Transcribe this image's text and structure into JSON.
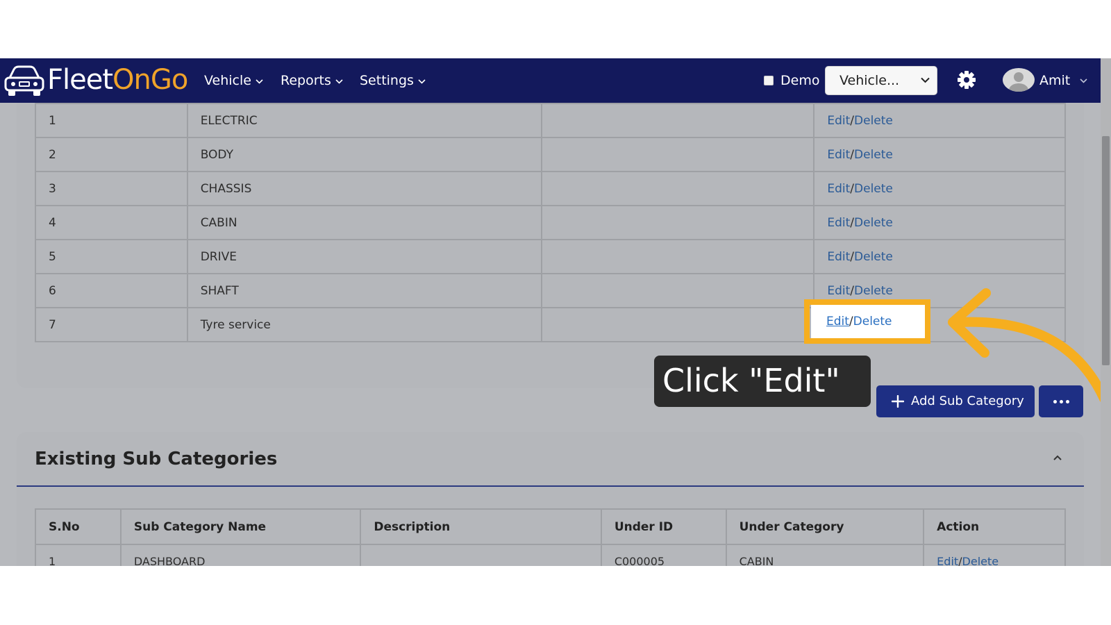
{
  "navbar": {
    "logo": {
      "part1": "Fleet",
      "part2": "On",
      "part3": "Go"
    },
    "menu": [
      {
        "label": "Vehicle"
      },
      {
        "label": "Reports"
      },
      {
        "label": "Settings"
      }
    ],
    "demo_label": "Demo",
    "vehicle_select_value": "Vehicle...",
    "user_name": "Amit"
  },
  "categories_table": {
    "rows": [
      {
        "sno": "1",
        "name": "ELECTRIC",
        "description": ""
      },
      {
        "sno": "2",
        "name": "BODY",
        "description": ""
      },
      {
        "sno": "3",
        "name": "CHASSIS",
        "description": ""
      },
      {
        "sno": "4",
        "name": "CABIN",
        "description": ""
      },
      {
        "sno": "5",
        "name": "DRIVE",
        "description": ""
      },
      {
        "sno": "6",
        "name": "SHAFT",
        "description": ""
      },
      {
        "sno": "7",
        "name": "Tyre service",
        "description": ""
      }
    ],
    "edit_label": "Edit",
    "separator": "/",
    "delete_label": "Delete"
  },
  "callout": {
    "text": "Click \"Edit\""
  },
  "buttons": {
    "add_sub_category": "Add Sub Category"
  },
  "sub_categories": {
    "title": "Existing Sub Categories",
    "headers": [
      "S.No",
      "Sub Category Name",
      "Description",
      "Under ID",
      "Under Category",
      "Action"
    ],
    "rows": [
      {
        "sno": "1",
        "name": "DASHBOARD",
        "description": "",
        "under_id": "C000005",
        "under_category": "CABIN"
      }
    ]
  },
  "colors": {
    "navbar": "#13195c",
    "highlight": "#f6ae1f",
    "primary_button": "#1e2f84",
    "link": "#2a5a96"
  }
}
